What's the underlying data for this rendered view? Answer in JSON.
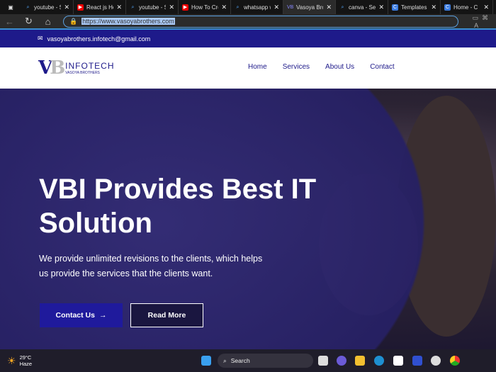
{
  "browser": {
    "tabs": [
      {
        "label": "youtube - S",
        "icon": "search-icon"
      },
      {
        "label": "React js Ho",
        "icon": "youtube-icon"
      },
      {
        "label": "youtube - S",
        "icon": "search-icon"
      },
      {
        "label": "How To Cre",
        "icon": "youtube-icon"
      },
      {
        "label": "whatsapp w",
        "icon": "search-icon"
      },
      {
        "label": "Vasoya Brot",
        "icon": "vb-icon",
        "active": true
      },
      {
        "label": "canva - Sea",
        "icon": "search-icon"
      },
      {
        "label": "Templates",
        "icon": "canva-icon"
      },
      {
        "label": "Home - C",
        "icon": "canva-icon"
      }
    ],
    "url": "https://www.vasoyabrothers.com"
  },
  "site": {
    "email": "vasoyabrothers.infotech@gmail.com",
    "logo": {
      "mark": "VB",
      "name": "INFOTECH",
      "sub": "VASOYA BROTHERS"
    },
    "nav": [
      "Home",
      "Services",
      "About Us",
      "Contact"
    ],
    "hero": {
      "title": "VBI Provides Best IT Solution",
      "text": "We provide unlimited revisions to the clients, which helps us provide the services that the clients want.",
      "contact": "Contact Us",
      "read": "Read More"
    }
  },
  "taskbar": {
    "temp": "29°C",
    "weather": "Haze",
    "search": "Search"
  }
}
